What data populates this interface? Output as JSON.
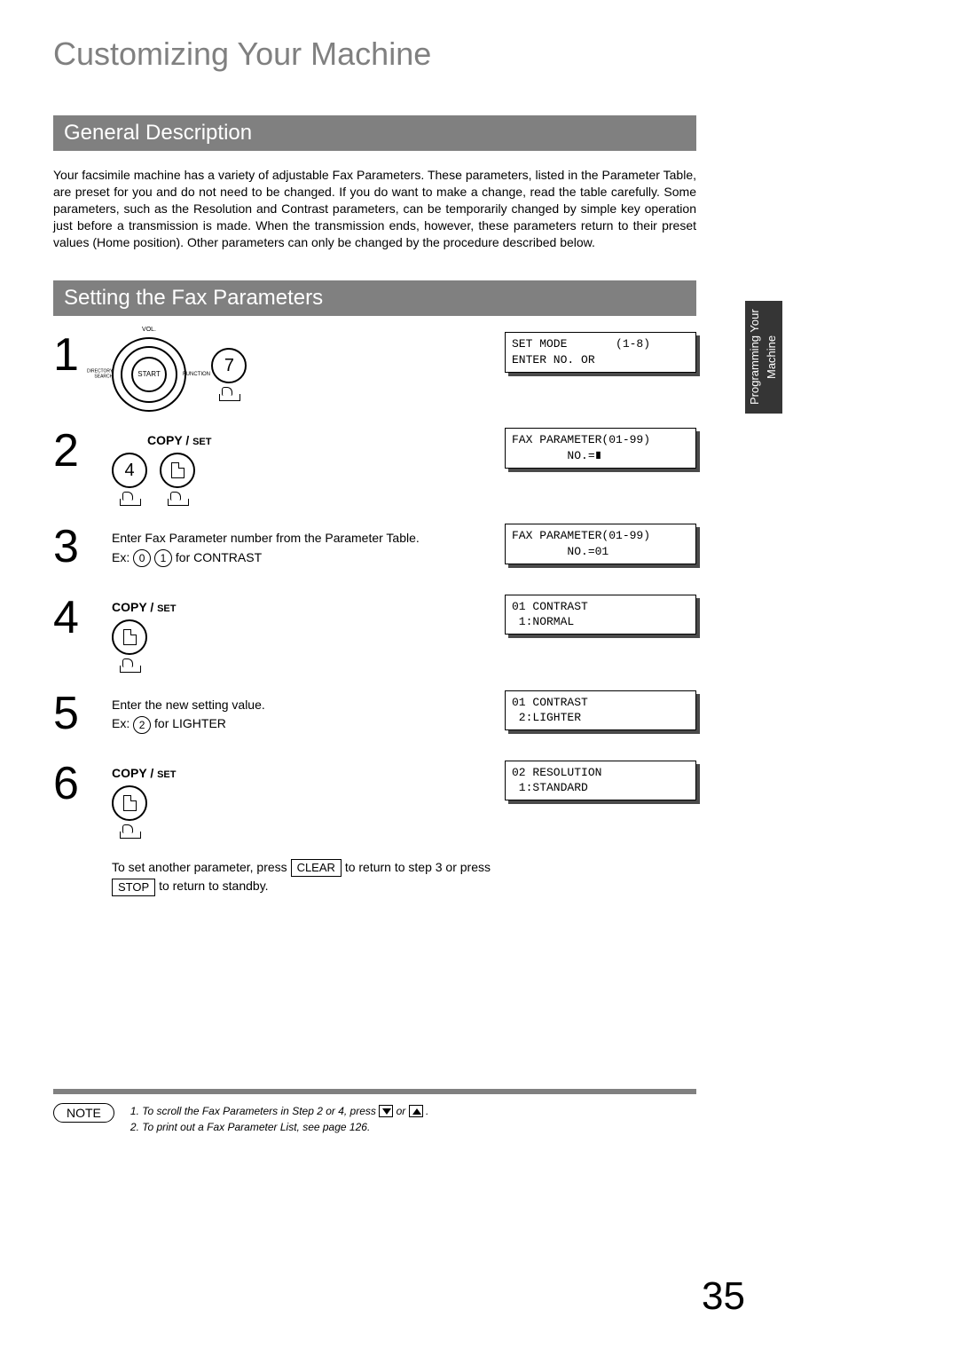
{
  "page_title": "Customizing Your Machine",
  "side_tab": "Programming\nYour Machine",
  "section1": {
    "title": "General Description",
    "body": "Your facsimile machine has a variety of adjustable Fax Parameters. These parameters, listed in the Parameter Table, are preset for you and do not need to be changed. If you do want to make a change, read the table carefully. Some parameters, such as the Resolution and Contrast parameters, can be temporarily changed by simple key operation just before a transmission is made. When the transmission ends, however, these parameters return to their preset values (Home position). Other parameters can only be changed by the procedure described below."
  },
  "section2": {
    "title": "Setting the  Fax Parameters"
  },
  "steps": {
    "s1": {
      "num": "1",
      "dial_center": "START",
      "dial_top": "VOL.",
      "dial_left": "DIRECTORY\nSEARCH",
      "dial_right": "FUNCTION",
      "key": "7",
      "lcd": "SET MODE       (1-8)\nENTER NO. OR"
    },
    "s2": {
      "num": "2",
      "copyset_a": "COPY / ",
      "copyset_b": "SET",
      "key4": "4",
      "lcd": "FAX PARAMETER(01-99)\n        NO.=∎"
    },
    "s3": {
      "num": "3",
      "line1": "Enter Fax Parameter number from the Parameter Table.",
      "ex_pre": "Ex: ",
      "k0": "0",
      "k1": "1",
      "ex_post": " for CONTRAST",
      "lcd": "FAX PARAMETER(01-99)\n        NO.=01"
    },
    "s4": {
      "num": "4",
      "copyset_a": "COPY / ",
      "copyset_b": "SET",
      "lcd": "01 CONTRAST\n 1:NORMAL"
    },
    "s5": {
      "num": "5",
      "line1": "Enter the new setting value.",
      "ex_pre": "Ex: ",
      "k2": "2",
      "ex_post": " for LIGHTER",
      "lcd": "01 CONTRAST\n 2:LIGHTER"
    },
    "s6": {
      "num": "6",
      "copyset_a": "COPY / ",
      "copyset_b": "SET",
      "lcd": "02 RESOLUTION\n 1:STANDARD",
      "tail_a": "To set another parameter, press ",
      "tail_clear": "CLEAR",
      "tail_b": " to return to step 3 or press ",
      "tail_stop": "  STOP  ",
      "tail_c": " to return to standby."
    }
  },
  "footer": {
    "note_label": "NOTE",
    "n1_a": "1. To scroll the Fax Parameters in Step 2 or 4, press ",
    "n1_b": " or ",
    "n1_c": " .",
    "n2": "2. To print out a Fax Parameter List, see page 126."
  },
  "page_number": "35"
}
